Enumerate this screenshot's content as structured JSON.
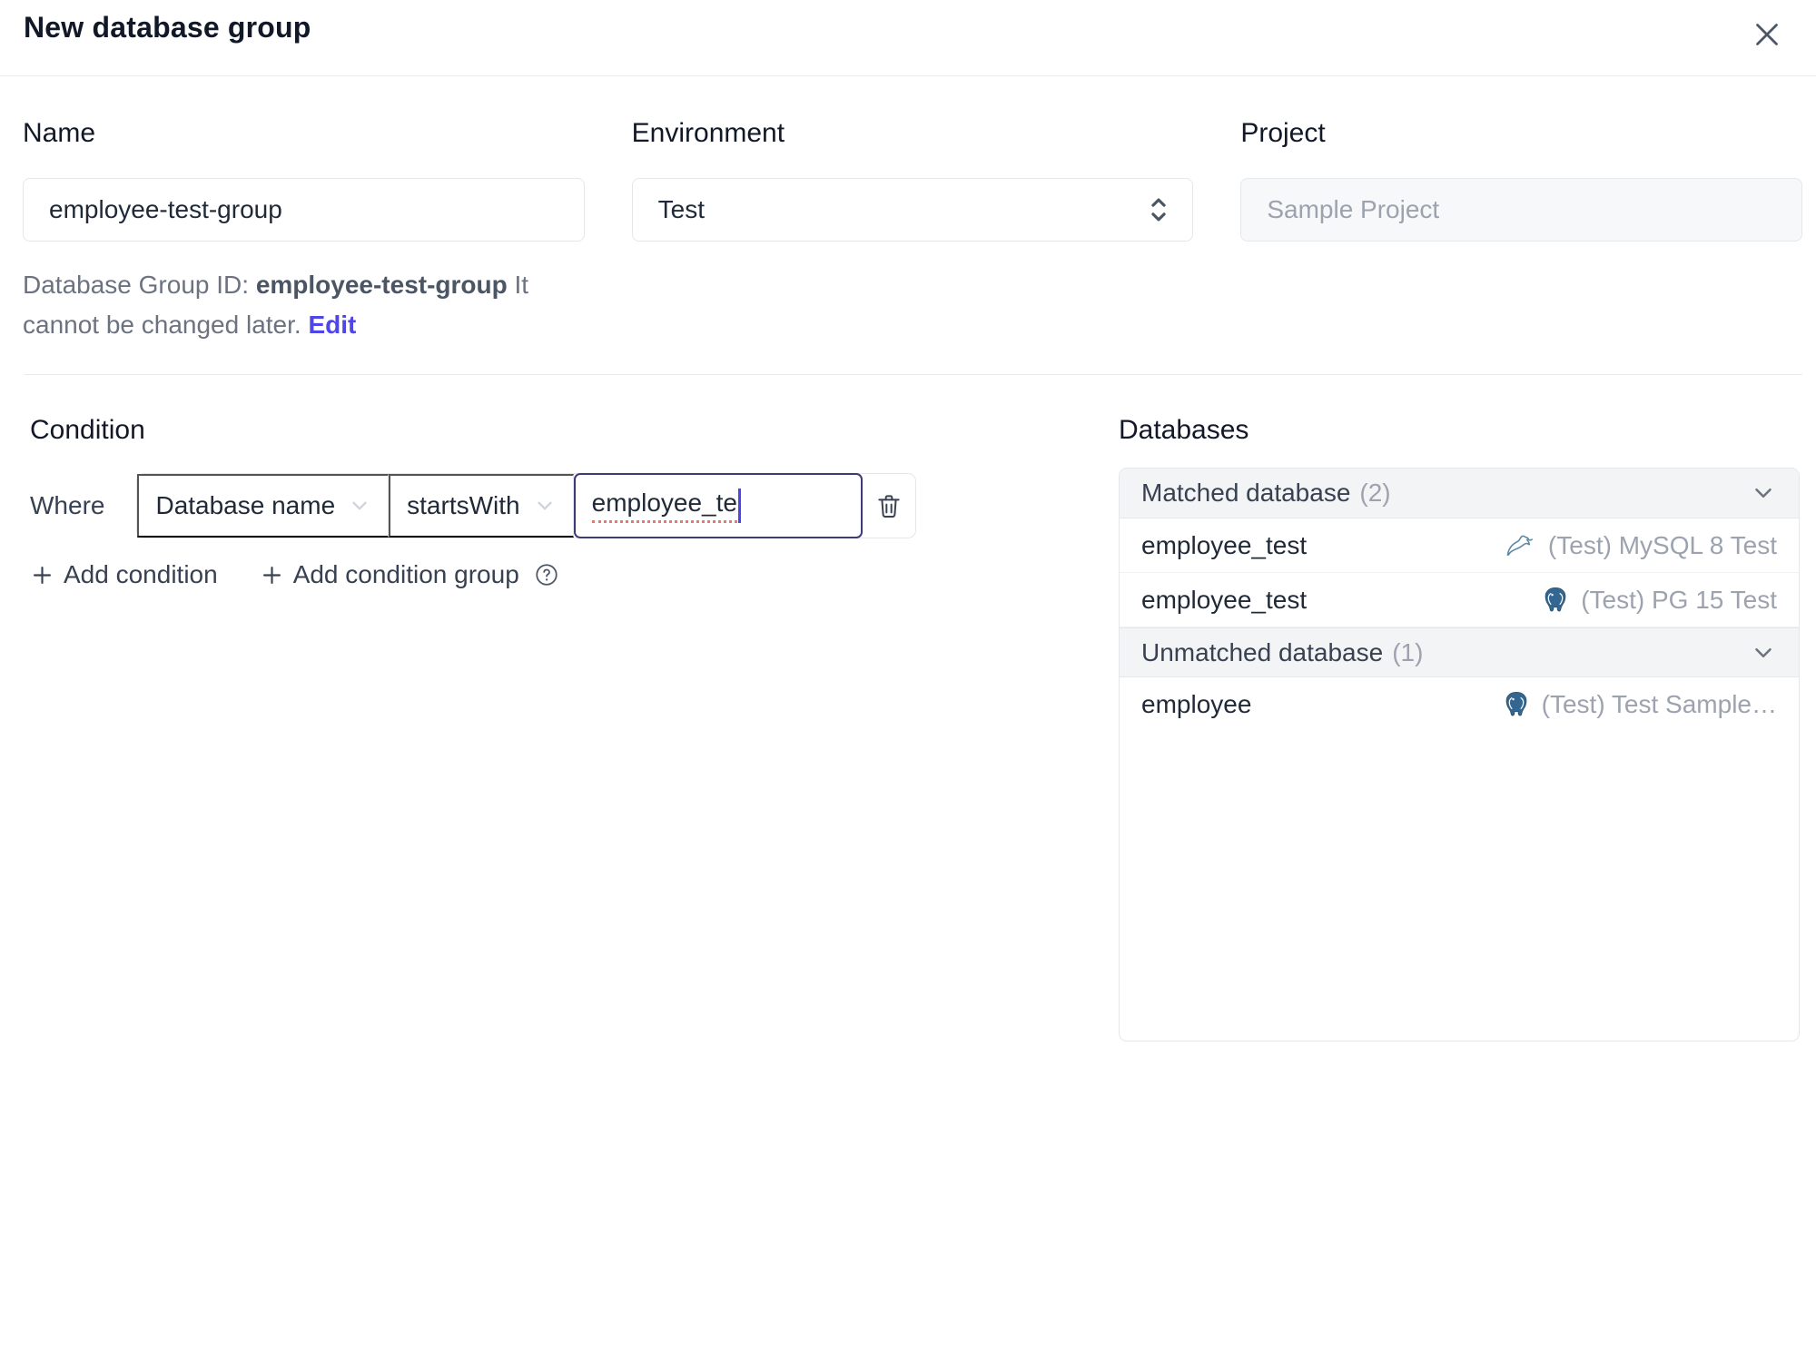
{
  "header": {
    "title": "New database group"
  },
  "form": {
    "name": {
      "label": "Name",
      "value": "employee-test-group"
    },
    "environment": {
      "label": "Environment",
      "value": "Test"
    },
    "project": {
      "label": "Project",
      "value": "Sample Project"
    },
    "group_id_note": {
      "prefix": "Database Group ID: ",
      "id": "employee-test-group",
      "suffix": " It cannot be changed later. ",
      "edit_label": "Edit"
    }
  },
  "condition": {
    "title": "Condition",
    "where_label": "Where",
    "factor": "Database name",
    "operator": "startsWith",
    "value": "employee_te",
    "add_condition_label": "Add condition",
    "add_condition_group_label": "Add condition group"
  },
  "databases": {
    "title": "Databases",
    "matched": {
      "label": "Matched database",
      "count": "(2)",
      "rows": [
        {
          "name": "employee_test",
          "engine": "mysql",
          "instance": "(Test) MySQL 8 Test"
        },
        {
          "name": "employee_test",
          "engine": "postgres",
          "instance": "(Test) PG 15 Test"
        }
      ]
    },
    "unmatched": {
      "label": "Unmatched database",
      "count": "(1)",
      "rows": [
        {
          "name": "employee",
          "engine": "postgres",
          "instance": "(Test) Test Sample…"
        }
      ]
    }
  },
  "icons": {
    "close": "close-icon",
    "select": "updown-chevrons-icon",
    "dropdown": "chevron-down-icon",
    "delete": "trash-icon",
    "add": "plus-icon",
    "help": "question-circle-icon",
    "mysql": "mysql-dolphin-icon",
    "postgres": "postgres-elephant-icon"
  },
  "colors": {
    "accent": "#4f46e5",
    "focus_border": "#3d3a7c",
    "spellcheck_underline": "#f2736a",
    "mysql_brand": "#5d87a1",
    "postgres_brand": "#336791",
    "section_header_bg": "#f3f4f6",
    "muted_text": "#9ca3af"
  }
}
